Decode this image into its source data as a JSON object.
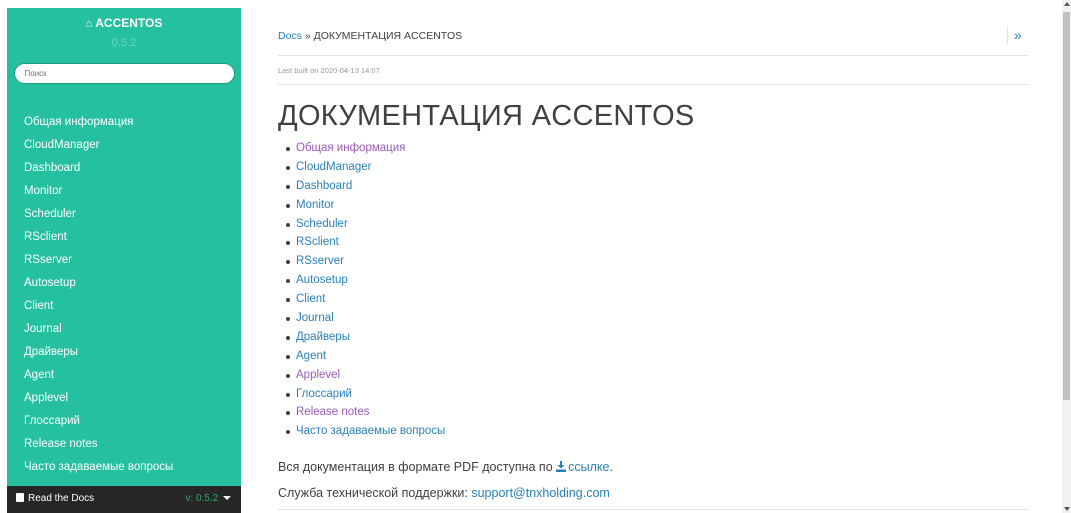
{
  "sidebar": {
    "title": "ACCENTOS",
    "version": "0.5.2",
    "search_placeholder": "Поиск",
    "items": [
      {
        "label": "Общая информация"
      },
      {
        "label": "CloudManager"
      },
      {
        "label": "Dashboard"
      },
      {
        "label": "Monitor"
      },
      {
        "label": "Scheduler"
      },
      {
        "label": "RSclient"
      },
      {
        "label": "RSserver"
      },
      {
        "label": "Autosetup"
      },
      {
        "label": "Client"
      },
      {
        "label": "Journal"
      },
      {
        "label": "Драйверы"
      },
      {
        "label": "Agent"
      },
      {
        "label": "Applevel"
      },
      {
        "label": "Глоссарий"
      },
      {
        "label": "Release notes"
      },
      {
        "label": "Часто задаваемые вопросы"
      }
    ],
    "footer": {
      "read_the_docs": "Read the Docs",
      "version_label": "v: 0.5.2"
    }
  },
  "header": {
    "breadcrumb_docs": "Docs",
    "breadcrumb_sep": " » ",
    "breadcrumb_current": "ДОКУМЕНТАЦИЯ ACCENTOS",
    "expand_icon": "»",
    "last_built": "Last built on 2020-04-13 14:07"
  },
  "main": {
    "title": "ДОКУМЕНТАЦИЯ ACCENTOS",
    "toc": [
      {
        "label": "Общая информация",
        "visited": true
      },
      {
        "label": "CloudManager",
        "visited": false
      },
      {
        "label": "Dashboard",
        "visited": false
      },
      {
        "label": "Monitor",
        "visited": false
      },
      {
        "label": "Scheduler",
        "visited": false
      },
      {
        "label": "RSclient",
        "visited": false
      },
      {
        "label": "RSserver",
        "visited": false
      },
      {
        "label": "Autosetup",
        "visited": false
      },
      {
        "label": "Client",
        "visited": false
      },
      {
        "label": "Journal",
        "visited": false
      },
      {
        "label": "Драйверы",
        "visited": false
      },
      {
        "label": "Agent",
        "visited": false
      },
      {
        "label": "Applevel",
        "visited": true
      },
      {
        "label": "Глоссарий",
        "visited": false
      },
      {
        "label": "Release notes",
        "visited": true
      },
      {
        "label": "Часто задаваемые вопросы",
        "visited": false
      }
    ],
    "pdf_text": "Вся документация в формате PDF доступна по ",
    "pdf_link": "ссылке",
    "pdf_end": ".",
    "support_text": "Служба технической поддержки: ",
    "support_email": "support@tnxholding.com"
  },
  "colors": {
    "sidebar_bg": "#25c0a0",
    "link": "#2980b9",
    "visited_link": "#9b59b6",
    "footer_bg": "#272525",
    "footer_version": "#27ae60"
  }
}
